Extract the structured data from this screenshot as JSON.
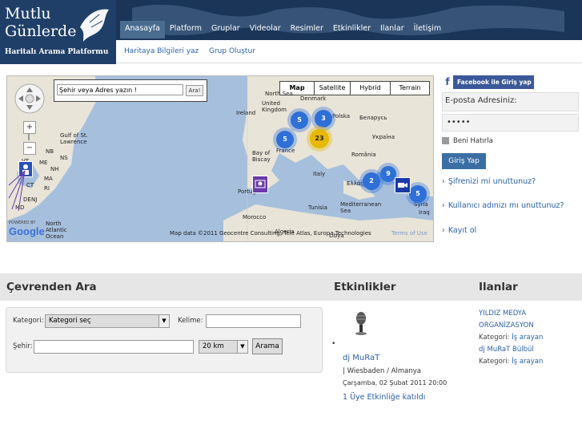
{
  "logo": {
    "line1": "Mutlu",
    "line2": "Günlerde",
    "line3": "Haritalı Arama Platformu"
  },
  "nav": [
    "Anasayfa",
    "Platform",
    "Gruplar",
    "Videolar",
    "Resimler",
    "Etkinlikler",
    "Ilanlar",
    "İletişim"
  ],
  "subnav": [
    "Haritaya Bilgileri yaz",
    "Grup Oluştur"
  ],
  "map": {
    "search_placeholder": "Şehir veya Adres yazın !",
    "search_button": "Ara!",
    "types": [
      "Map",
      "Satellite",
      "Hybrid",
      "Terrain"
    ],
    "active_type": "Map",
    "clusters": [
      "5",
      "3",
      "23",
      "5",
      "2",
      "9",
      "5"
    ],
    "labels": [
      "North Sea",
      "Denmark",
      "United Kingdom",
      "Ireland",
      "Polska",
      "Беларусь",
      "France",
      "Україна",
      "Gulf of St. Lawrence",
      "NB",
      "NS",
      "ME",
      "VT",
      "NH",
      "MA",
      "CT",
      "RI",
      "DE",
      "NJ",
      "MD",
      "Bay of Biscay",
      "Portugal",
      "Italy",
      "România",
      "Ελλάς",
      "Mediterranean Sea",
      "Syria",
      "Iraq",
      "Morocco",
      "North Atlantic Ocean",
      "Tunisia",
      "Libya",
      "Algeria"
    ],
    "credit": "Map data ©2011 Geocentre Consulting, Tele Atlas, Europa Technologies",
    "terms": "Terms of Use",
    "powered": "POWERED BY",
    "google": "Google"
  },
  "login": {
    "facebook": "Facebook ile Giriş yap",
    "email_label": "E-posta Adresiniz:",
    "password": "•••••",
    "remember": "Beni Hatırla",
    "submit": "Giriş Yap",
    "links": [
      "Şifrenizi mi unuttunuz?",
      "Kullanıcı adınızı mı unuttunuz?",
      "Kayıt ol"
    ]
  },
  "sections": {
    "search": "Çevrenden Ara",
    "events": "Etkinlikler",
    "ads": "Ilanlar"
  },
  "search_form": {
    "category_label": "Kategori:",
    "category_value": "Kategori seç",
    "keyword_label": "Kelime:",
    "city_label": "Şehir:",
    "distance_value": "20 km",
    "button": "Arama"
  },
  "event": {
    "name": "dj MuRaT",
    "location": "| Wiesbaden / Almanya",
    "date": "Çarşamba, 02 Şubat 2011 20:00",
    "attendees": "1 Üye Etkinliğe katıldı"
  },
  "ads": [
    {
      "title": "YILDIZ MEDYA ORGANİZASYON",
      "cat_label": "Kategori:",
      "cat_value": "İş arayan"
    },
    {
      "title": "dj MuRaT Bülbül",
      "cat_label": "Kategori:",
      "cat_value": "İş arayan"
    }
  ]
}
